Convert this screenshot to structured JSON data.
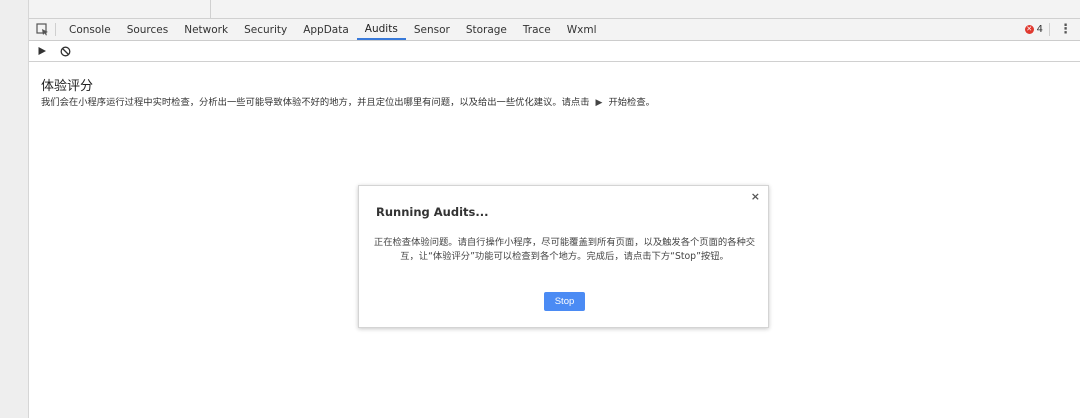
{
  "tabs": [
    "Console",
    "Sources",
    "Network",
    "Security",
    "AppData",
    "Audits",
    "Sensor",
    "Storage",
    "Trace",
    "Wxml"
  ],
  "active_tab": "Audits",
  "error_count": "4",
  "icons": {
    "inspect": "inspect-element-icon",
    "play": "play-icon",
    "clear": "block-icon",
    "more": "kebab-menu-icon",
    "error": "error-icon",
    "close": "close-icon"
  },
  "colors": {
    "accent": "#3879d9",
    "error": "#e0392f",
    "button": "#4b8bf4"
  },
  "audits": {
    "title": "体验评分",
    "desc_before": "我们会在小程序运行过程中实时检查，分析出一些可能导致体验不好的地方，并且定位出哪里有问题，以及给出一些优化建议。请点击",
    "desc_play": "▶",
    "desc_after": "开始检查。"
  },
  "modal": {
    "title": "Running Audits...",
    "body": "正在检查体验问题。请自行操作小程序，尽可能覆盖到所有页面，以及触发各个页面的各种交互，让“体验评分”功能可以检查到各个地方。完成后，请点击下方“Stop”按钮。",
    "close_label": "×",
    "stop_label": "Stop"
  }
}
